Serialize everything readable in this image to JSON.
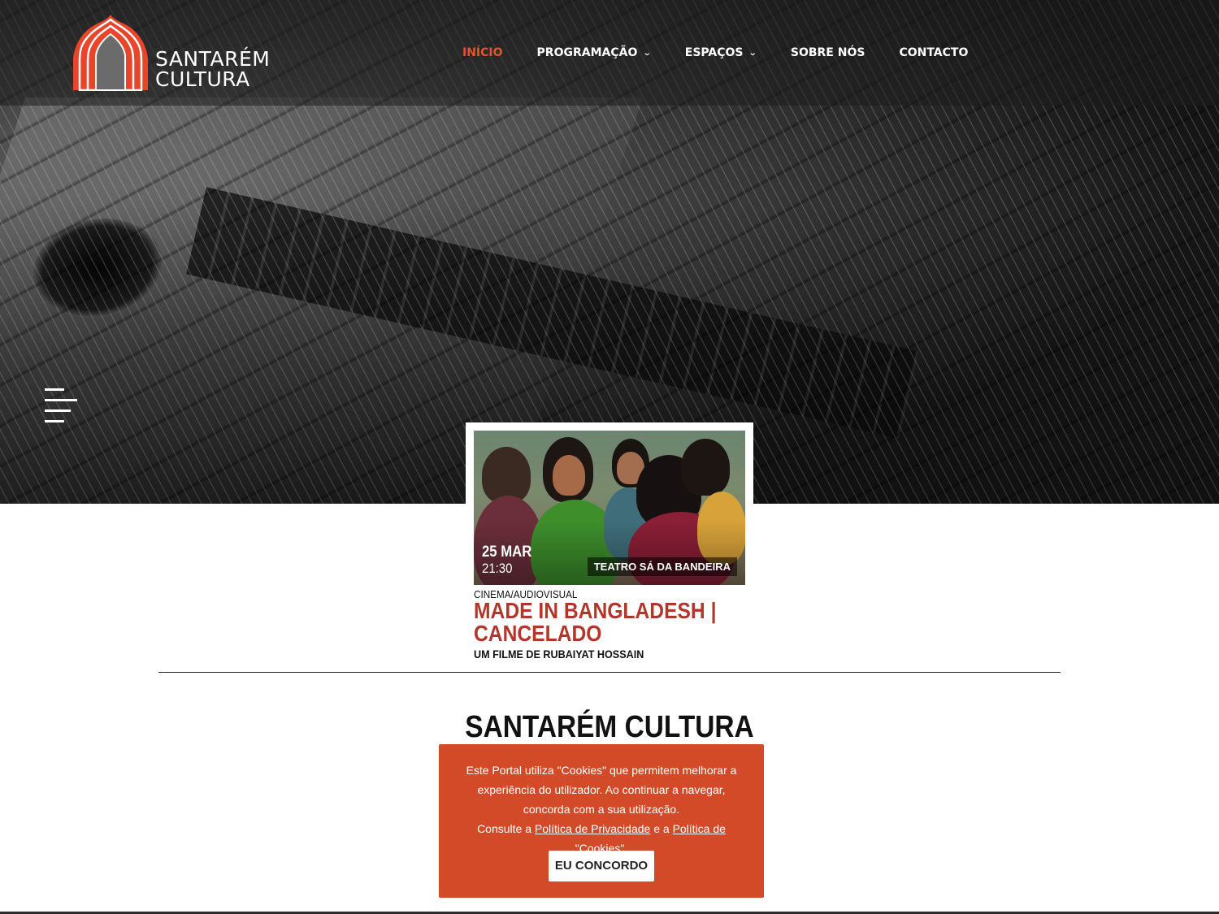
{
  "brand": {
    "name_line1": "SANTARÉM",
    "name_line2": "CULTURA",
    "accent_color": "#e2552d"
  },
  "nav": {
    "items": [
      {
        "label": "INÍCIO",
        "active": true,
        "has_dropdown": false
      },
      {
        "label": "PROGRAMAÇÃO",
        "active": false,
        "has_dropdown": true
      },
      {
        "label": "ESPAÇOS",
        "active": false,
        "has_dropdown": true
      },
      {
        "label": "SOBRE NÓS",
        "active": false,
        "has_dropdown": false
      },
      {
        "label": "CONTACTO",
        "active": false,
        "has_dropdown": false
      }
    ],
    "dropdown_icon": "chevron-down-icon"
  },
  "hero": {
    "menu_icon": "hamburger-menu-icon"
  },
  "event": {
    "date": "25 MAR",
    "time": "21:30",
    "venue": "TEATRO SÁ DA BANDEIRA",
    "category": "CINEMA/AUDIOVISUAL",
    "title": "MADE IN BANGLADESH | CANCELADO",
    "subtitle": "UM FILME DE RUBAIYAT HOSSAIN",
    "title_color": "#b3362a"
  },
  "section": {
    "title": "SANTARÉM CULTURA"
  },
  "cookie_banner": {
    "text_part1": "Este Portal utiliza \"Cookies\" que permitem melhorar a experiência do utilizador. Ao continuar a navegar, concorda com a sua utilização.",
    "text_part2_prefix": "Consulte a ",
    "privacy_link": "Política de Privacidade",
    "text_part2_middle": " e a ",
    "cookies_link": "Política de \"Cookies\"",
    "text_part2_suffix": ".",
    "button_label": "EU CONCORDO",
    "background_color": "#d34a29"
  }
}
